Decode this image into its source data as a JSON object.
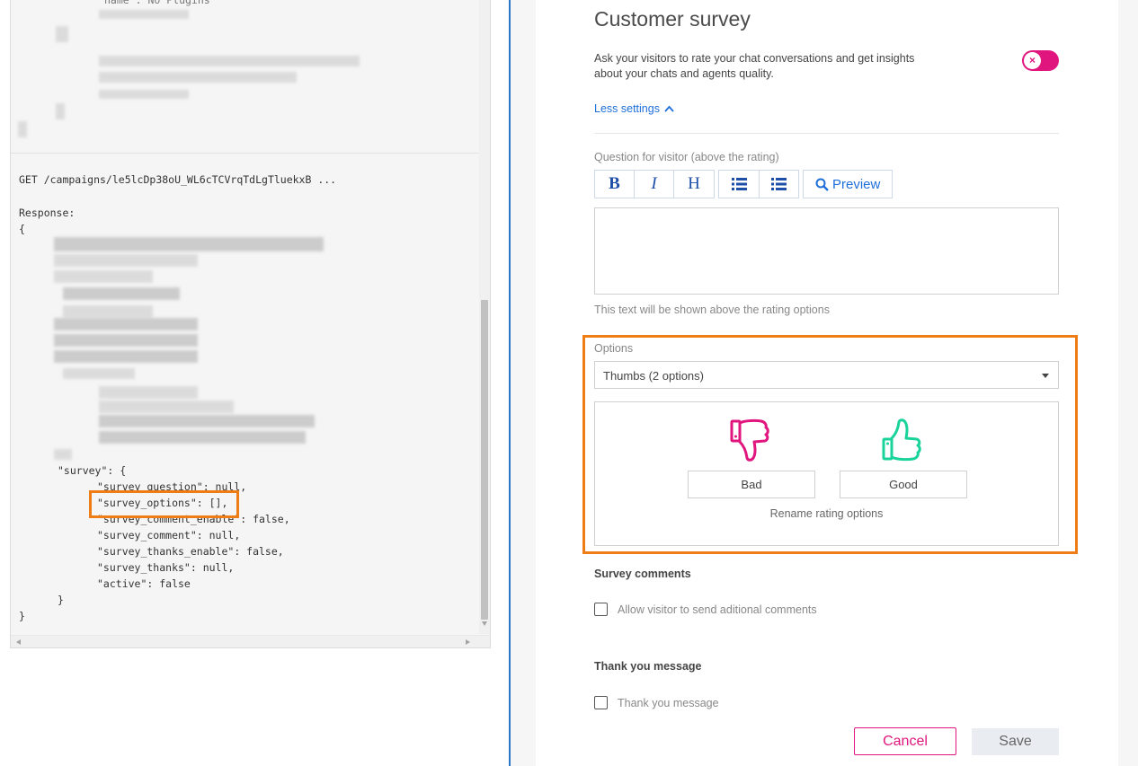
{
  "code_panel": {
    "top_fragment": "name : No Plugins",
    "request_line": "GET /campaigns/le5lcDp38oU_WL6cTCVrqTdLgTluekxB ...",
    "response_label": "Response:",
    "open_brace": "{",
    "survey_key": "\"survey\": {",
    "survey_lines": [
      "\"survey_question\": null,",
      "\"survey_options\": [],",
      "\"survey_comment_enable\": false,",
      "\"survey_comment\": null,",
      "\"survey_thanks_enable\": false,",
      "\"survey_thanks\": null,",
      "\"active\": false"
    ],
    "inner_close": "}",
    "close_brace": "}"
  },
  "settings": {
    "title": "Customer survey",
    "description": "Ask your visitors to rate your chat conversations and get insights about your chats and agents quality.",
    "toggle_state": "off",
    "toggle_glyph": "×",
    "less_settings": "Less settings",
    "question_label": "Question for visitor (above the rating)",
    "toolbar": {
      "bold": "B",
      "italic": "I",
      "heading": "H",
      "preview": "Preview"
    },
    "question_hint": "This text will be shown above the rating options",
    "options_label": "Options",
    "options_selected": "Thumbs (2 options)",
    "rating": {
      "bad_label": "Bad",
      "good_label": "Good",
      "rename": "Rename rating options",
      "bad_color": "#e0157e",
      "good_color": "#19d39a"
    },
    "comments_title": "Survey comments",
    "comments_checkbox": "Allow visitor to send aditional comments",
    "thanks_title": "Thank you message",
    "thanks_checkbox": "Thank you message",
    "cancel": "Cancel",
    "save": "Save"
  },
  "colors": {
    "accent": "#e0157e",
    "link": "#1e6fd9",
    "highlight": "#ee7d16"
  }
}
